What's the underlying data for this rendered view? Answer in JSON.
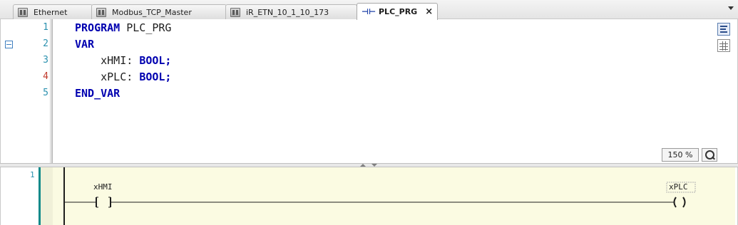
{
  "tabs": [
    {
      "label": "Ethernet",
      "icon": "device-icon",
      "active": false
    },
    {
      "label": "Modbus_TCP_Master",
      "icon": "device-icon",
      "active": false
    },
    {
      "label": "iR_ETN_10_1_10_173",
      "icon": "device-icon",
      "active": false
    },
    {
      "label": "PLC_PRG",
      "icon": "program-icon",
      "active": true,
      "close": "×"
    }
  ],
  "declaration": {
    "line_numbers": [
      "1",
      "2",
      "3",
      "4",
      "5"
    ],
    "modified_line": "4",
    "lines": [
      {
        "keyword": "PROGRAM",
        "rest": " PLC_PRG"
      },
      {
        "keyword": "VAR",
        "rest": ""
      },
      {
        "indent": "    ",
        "name": "xHMI: ",
        "type": "BOOL;"
      },
      {
        "indent": "    ",
        "name": "xPLC: ",
        "type": "BOOL;"
      },
      {
        "keyword": "END_VAR",
        "rest": ""
      }
    ],
    "zoom": "150 %"
  },
  "ladder": {
    "network_number": "1",
    "contact_variable": "xHMI",
    "coil_variable": "xPLC",
    "contact_symbol": "| |",
    "coil_symbol": "( )"
  },
  "colors": {
    "keyword": "#0000b0",
    "line_number": "#2b91af",
    "modified_line_number": "#c0392b",
    "ladder_background": "#fbfbe2",
    "network_bar": "#0f8a8a"
  }
}
